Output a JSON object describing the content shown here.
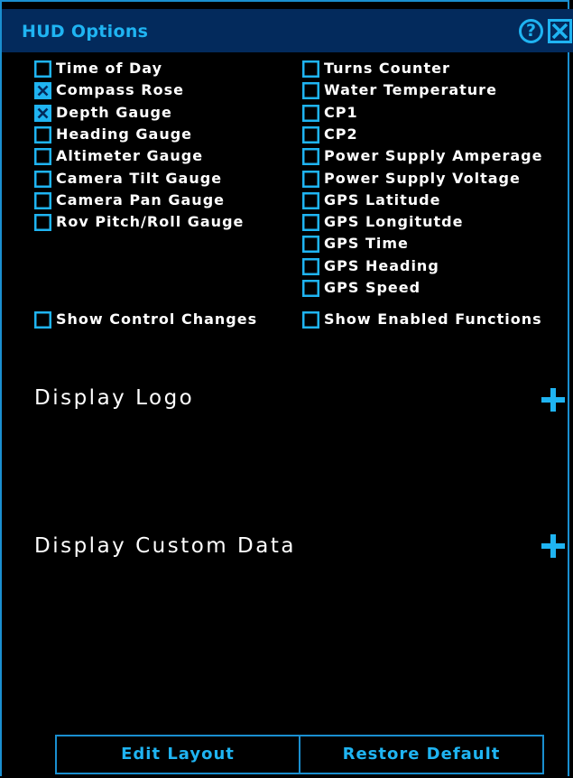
{
  "title": "HUD Options",
  "colors": {
    "accent": "#1fb4f2",
    "titlebar_bg": "#032a5c",
    "border": "#1a8fd0",
    "text": "#ffffff",
    "background": "#000000"
  },
  "header": {
    "help_glyph": "?",
    "help_icon": "question-circle-icon",
    "close_icon": "close-x-box-icon"
  },
  "left_options": [
    {
      "label": "Time of Day",
      "checked": false
    },
    {
      "label": "Compass Rose",
      "checked": true
    },
    {
      "label": "Depth Gauge",
      "checked": true
    },
    {
      "label": "Heading Gauge",
      "checked": false
    },
    {
      "label": "Altimeter Gauge",
      "checked": false
    },
    {
      "label": "Camera Tilt Gauge",
      "checked": false
    },
    {
      "label": "Camera Pan Gauge",
      "checked": false
    },
    {
      "label": "Rov Pitch/Roll Gauge",
      "checked": false
    }
  ],
  "right_options": [
    {
      "label": "Turns Counter",
      "checked": false
    },
    {
      "label": "Water Temperature",
      "checked": false
    },
    {
      "label": "CP1",
      "checked": false
    },
    {
      "label": "CP2",
      "checked": false
    },
    {
      "label": "Power Supply Amperage",
      "checked": false
    },
    {
      "label": "Power Supply Voltage",
      "checked": false
    },
    {
      "label": "GPS Latitude",
      "checked": false
    },
    {
      "label": "GPS Longitutde",
      "checked": false
    },
    {
      "label": "GPS Time",
      "checked": false
    },
    {
      "label": "GPS Heading",
      "checked": false
    },
    {
      "label": "GPS Speed",
      "checked": false
    }
  ],
  "show_control_changes": {
    "label": "Show Control Changes",
    "checked": false
  },
  "show_enabled_functions": {
    "label": "Show Enabled Functions",
    "checked": false
  },
  "sections": {
    "display_logo": "Display Logo",
    "display_custom_data": "Display Custom Data",
    "expand_icon": "plus-icon"
  },
  "buttons": {
    "edit_layout": "Edit Layout",
    "restore_default": "Restore Default"
  }
}
